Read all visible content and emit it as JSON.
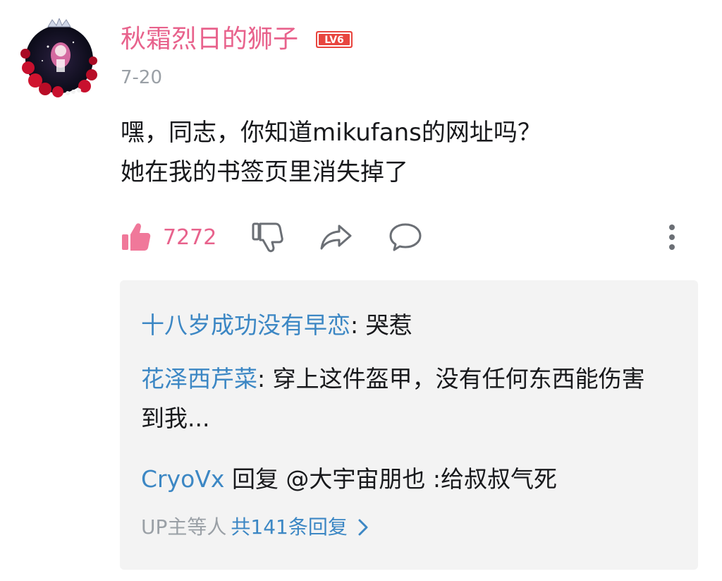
{
  "comment": {
    "username": "秋霜烈日的狮子",
    "level_badge": "LV6",
    "date": "7-20",
    "text_lines": [
      "嘿，同志，你知道mikufans的网址吗？",
      "她在我的书签页里消失掉了"
    ],
    "like_count": "7272"
  },
  "icons": {
    "like": "thumbs-up-icon",
    "dislike": "thumbs-down-icon",
    "share": "share-icon",
    "reply": "comment-bubble-icon",
    "more": "more-vertical-icon",
    "expand": "chevron-right-icon"
  },
  "replies": [
    {
      "author": "十八岁成功没有早恋",
      "separator": ": ",
      "text": "哭惹"
    },
    {
      "author": "花泽西芹菜",
      "separator": ": ",
      "text": "穿上这件盔甲，没有任何东西能伤害到我..."
    },
    {
      "author": "CryoVx",
      "separator": " ",
      "text": "回复 @大宇宙朋也 :给叔叔气死"
    }
  ],
  "more_replies": {
    "prefix": "UP主等人",
    "count_text": "共141条回复"
  },
  "colors": {
    "username": "#e8628c",
    "like": "#f0789a",
    "link": "#3c87c4",
    "muted": "#9aa0a6",
    "reply_box_bg": "#f3f3f3"
  }
}
